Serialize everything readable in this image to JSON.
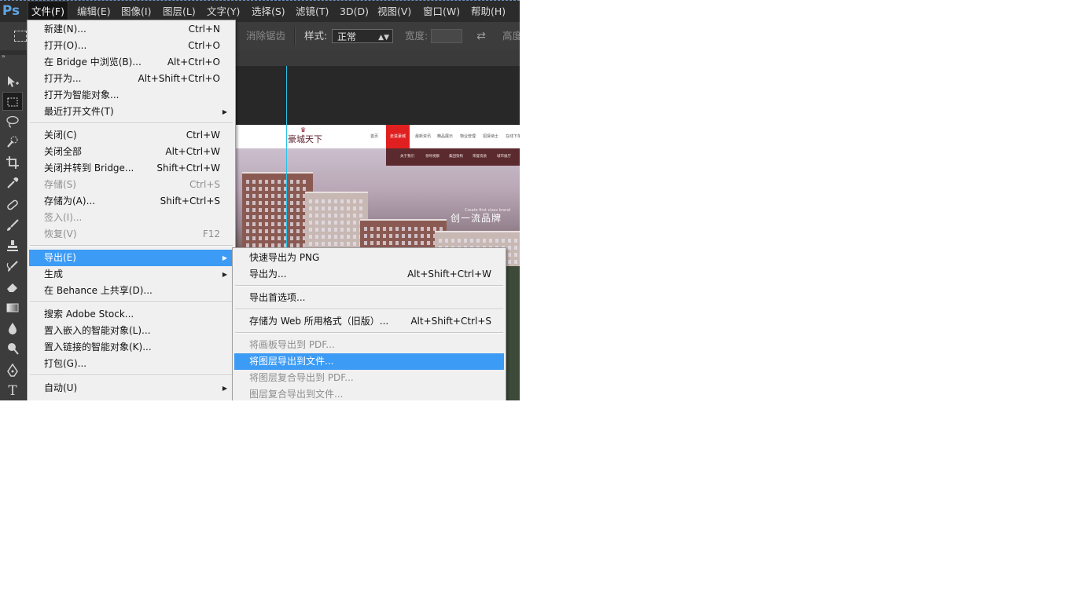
{
  "app": {
    "logo": "Ps"
  },
  "menubar": {
    "items": [
      {
        "label": "文件(F)"
      },
      {
        "label": "编辑(E)"
      },
      {
        "label": "图像(I)"
      },
      {
        "label": "图层(L)"
      },
      {
        "label": "文字(Y)"
      },
      {
        "label": "选择(S)"
      },
      {
        "label": "滤镜(T)"
      },
      {
        "label": "3D(D)"
      },
      {
        "label": "视图(V)"
      },
      {
        "label": "窗口(W)"
      },
      {
        "label": "帮助(H)"
      }
    ]
  },
  "options": {
    "antialias_label": "消除锯齿",
    "style_label": "样式:",
    "style_value": "正常",
    "width_label": "宽度:",
    "height_label": "高度"
  },
  "file_menu": {
    "items": [
      {
        "label": "新建(N)...",
        "shortcut": "Ctrl+N"
      },
      {
        "label": "打开(O)...",
        "shortcut": "Ctrl+O"
      },
      {
        "label": "在 Bridge 中浏览(B)...",
        "shortcut": "Alt+Ctrl+O"
      },
      {
        "label": "打开为...",
        "shortcut": "Alt+Shift+Ctrl+O"
      },
      {
        "label": "打开为智能对象...",
        "shortcut": ""
      },
      {
        "label": "最近打开文件(T)",
        "shortcut": ""
      },
      {
        "label": "关闭(C)",
        "shortcut": "Ctrl+W"
      },
      {
        "label": "关闭全部",
        "shortcut": "Alt+Ctrl+W"
      },
      {
        "label": "关闭并转到 Bridge...",
        "shortcut": "Shift+Ctrl+W"
      },
      {
        "label": "存储(S)",
        "shortcut": "Ctrl+S"
      },
      {
        "label": "存储为(A)...",
        "shortcut": "Shift+Ctrl+S"
      },
      {
        "label": "签入(I)...",
        "shortcut": ""
      },
      {
        "label": "恢复(V)",
        "shortcut": "F12"
      },
      {
        "label": "导出(E)",
        "shortcut": ""
      },
      {
        "label": "生成",
        "shortcut": ""
      },
      {
        "label": "在 Behance 上共享(D)...",
        "shortcut": ""
      },
      {
        "label": "搜索 Adobe Stock...",
        "shortcut": ""
      },
      {
        "label": "置入嵌入的智能对象(L)...",
        "shortcut": ""
      },
      {
        "label": "置入链接的智能对象(K)...",
        "shortcut": ""
      },
      {
        "label": "打包(G)...",
        "shortcut": ""
      },
      {
        "label": "自动(U)",
        "shortcut": ""
      }
    ]
  },
  "export_menu": {
    "items": [
      {
        "label": "快速导出为 PNG",
        "shortcut": ""
      },
      {
        "label": "导出为...",
        "shortcut": "Alt+Shift+Ctrl+W"
      },
      {
        "label": "导出首选项...",
        "shortcut": ""
      },
      {
        "label": "存储为 Web 所用格式（旧版）...",
        "shortcut": "Alt+Shift+Ctrl+S"
      },
      {
        "label": "将画板导出到 PDF...",
        "shortcut": ""
      },
      {
        "label": "将图层导出到文件...",
        "shortcut": ""
      },
      {
        "label": "将图层复合导出到 PDF...",
        "shortcut": ""
      },
      {
        "label": "图层复合导出到文件...",
        "shortcut": ""
      }
    ]
  },
  "document": {
    "logo_text": "豪城天下",
    "nav": [
      "首页",
      "走进豪城",
      "最新资讯",
      "精品展示",
      "物业管理",
      "招贤纳士",
      "在线下单"
    ],
    "subnav": [
      "关于我们",
      "领导视察",
      "集团架构",
      "荣誉资质",
      "城市展厅"
    ],
    "slogan": "创一流品牌",
    "slogan_en": "Create first class brand"
  }
}
